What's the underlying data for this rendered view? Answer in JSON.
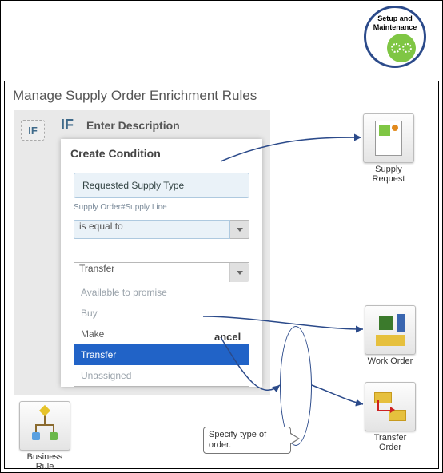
{
  "badge": {
    "label": "Setup and Maintenance"
  },
  "page": {
    "title": "Manage Supply Order Enrichment Rules"
  },
  "rule": {
    "if_chip": "IF",
    "if_inline": "IF",
    "enter_description": "Enter Description"
  },
  "condition": {
    "title": "Create Condition",
    "field_label": "Requested Supply Type",
    "field_path": "Supply Order#Supply Line",
    "operator": "is equal to",
    "value": "Transfer",
    "options": {
      "atp": "Available to promise",
      "buy": "Buy",
      "make": "Make",
      "transfer": "Transfer",
      "unassigned": "Unassigned"
    },
    "cancel": "ancel"
  },
  "tiles": {
    "supply_request": "Supply Request",
    "work_order": "Work Order",
    "transfer_order": "Transfer Order",
    "business_rule": "Business Rule"
  },
  "callout": {
    "text": "Specify type of order."
  }
}
